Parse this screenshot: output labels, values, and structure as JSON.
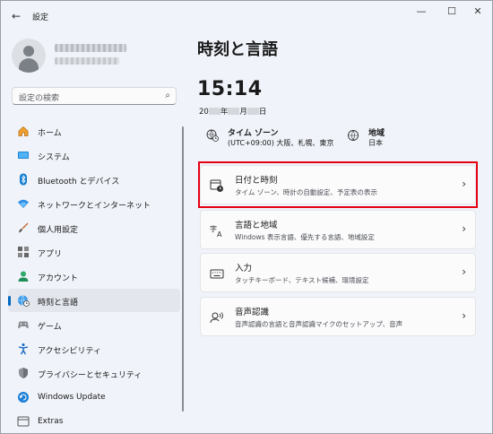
{
  "window": {
    "title": "設定"
  },
  "titlebar": {
    "back": "←",
    "minimize": "—",
    "maximize": "☐",
    "close": "✕"
  },
  "search": {
    "placeholder": "設定の検索",
    "icon": "search-icon"
  },
  "sidebar": {
    "items": [
      {
        "label": "ホーム",
        "icon": "home-icon"
      },
      {
        "label": "システム",
        "icon": "system-icon"
      },
      {
        "label": "Bluetooth とデバイス",
        "icon": "bluetooth-icon"
      },
      {
        "label": "ネットワークとインターネット",
        "icon": "wifi-icon"
      },
      {
        "label": "個人用設定",
        "icon": "brush-icon"
      },
      {
        "label": "アプリ",
        "icon": "apps-icon"
      },
      {
        "label": "アカウント",
        "icon": "account-icon"
      },
      {
        "label": "時刻と言語",
        "icon": "globe-clock-icon",
        "active": true
      },
      {
        "label": "ゲーム",
        "icon": "game-icon"
      },
      {
        "label": "アクセシビリティ",
        "icon": "accessibility-icon"
      },
      {
        "label": "プライバシーとセキュリティ",
        "icon": "shield-icon"
      },
      {
        "label": "Windows Update",
        "icon": "update-icon"
      },
      {
        "label": "Extras",
        "icon": "extras-icon"
      }
    ]
  },
  "main": {
    "title": "時刻と言語",
    "time": "15:14",
    "date": {
      "prefix": "20",
      "year_suffix": "年",
      "month_suffix": "月",
      "day_suffix": "日"
    },
    "timezone": {
      "title": "タイム ゾーン",
      "value": "(UTC+09:00) 大阪、札幌、東京"
    },
    "region": {
      "title": "地域",
      "value": "日本"
    },
    "cards": [
      {
        "title": "日付と時刻",
        "desc": "タイム ゾーン、時計の自動設定、予定表の表示",
        "icon": "calendar-clock-icon"
      },
      {
        "title": "言語と地域",
        "desc": "Windows 表示言語、優先する言語、地域設定",
        "icon": "language-icon"
      },
      {
        "title": "入力",
        "desc": "タッチキーボード、テキスト候補、環境設定",
        "icon": "keyboard-icon"
      },
      {
        "title": "音声認識",
        "desc": "音声認識の言語と音声認識マイクのセットアップ、音声",
        "icon": "speech-icon"
      }
    ]
  },
  "colors": {
    "accent": "#0067c0",
    "highlight": "#e60012",
    "background": "#f0f3f9"
  }
}
